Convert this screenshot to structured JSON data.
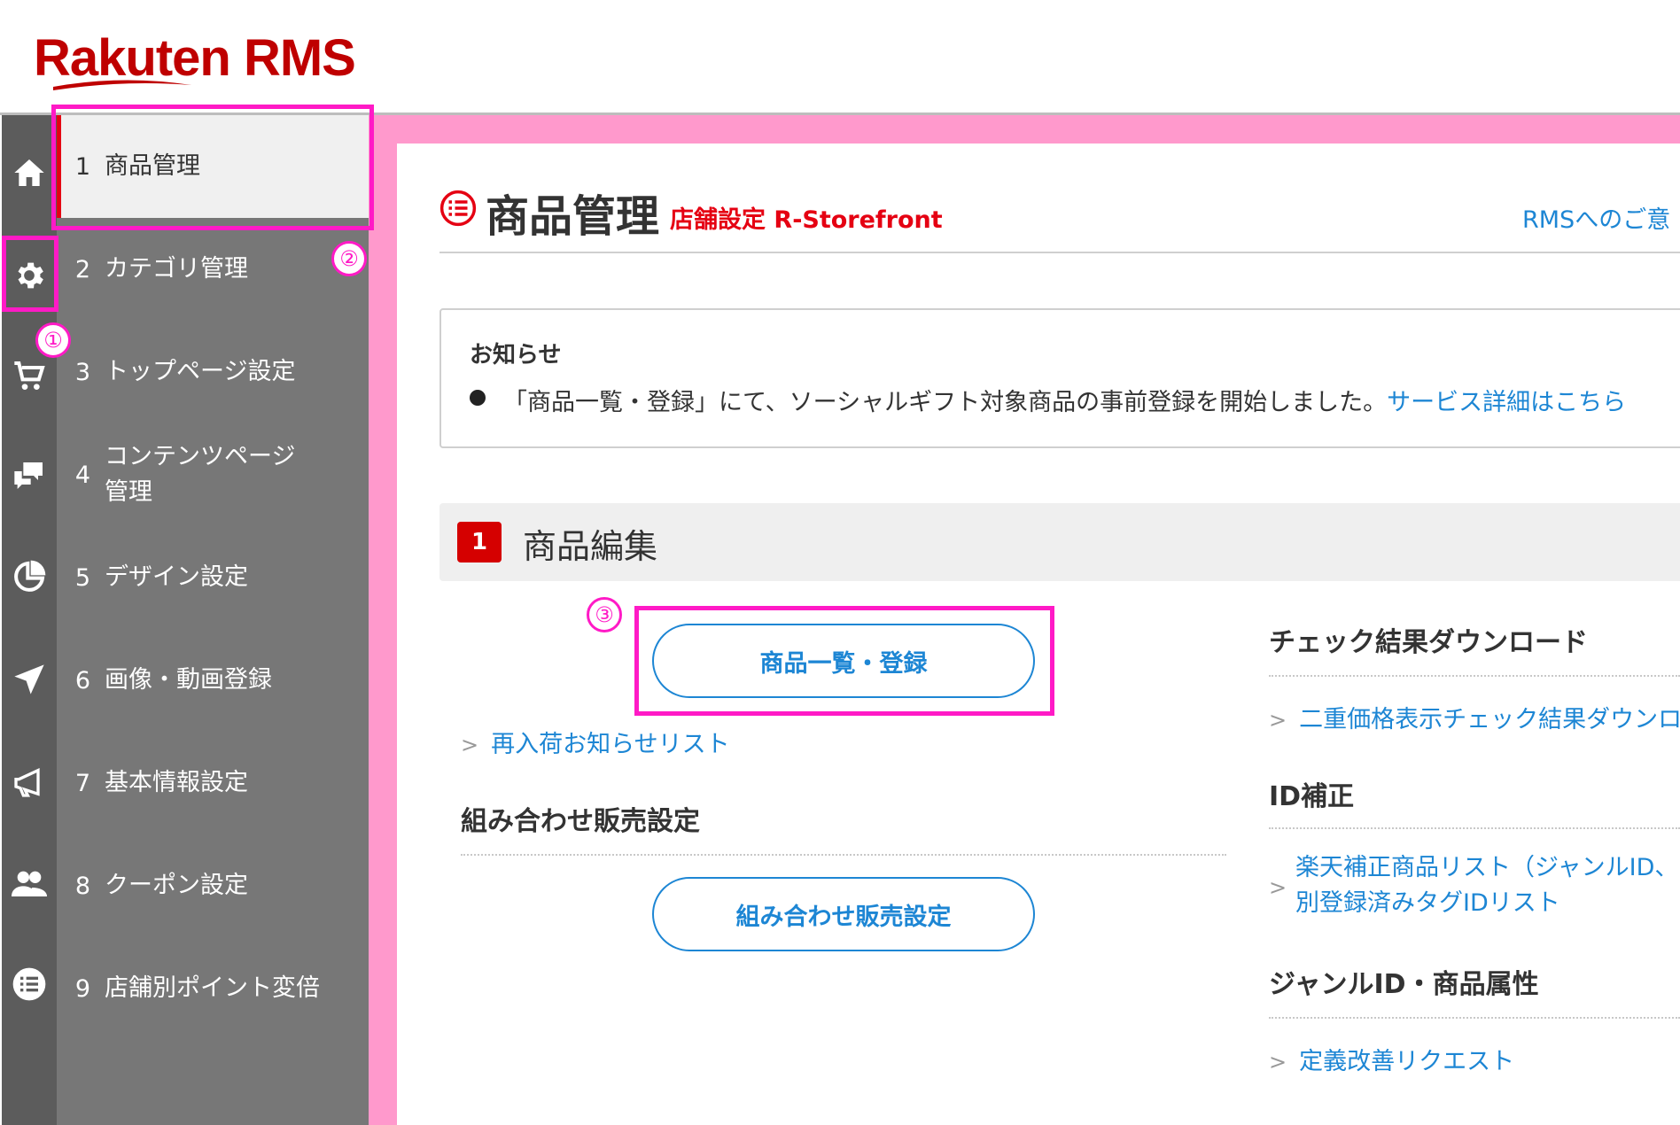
{
  "brand": {
    "name": "Rakuten RMS",
    "color": "#bf0000"
  },
  "rail_icons": [
    "home-icon",
    "gear-icon",
    "cart-icon",
    "chat-icon",
    "pie-chart-icon",
    "paper-plane-icon",
    "megaphone-icon",
    "people-icon",
    "list-icon"
  ],
  "menu": {
    "items": [
      {
        "num": "1",
        "label": "商品管理"
      },
      {
        "num": "2",
        "label": "カテゴリ管理"
      },
      {
        "num": "3",
        "label": "トップページ設定"
      },
      {
        "num": "4",
        "label": "コンテンツページ 管理"
      },
      {
        "num": "5",
        "label": "デザイン設定"
      },
      {
        "num": "6",
        "label": "画像・動画登録"
      },
      {
        "num": "7",
        "label": "基本情報設定"
      },
      {
        "num": "8",
        "label": "クーポン設定"
      },
      {
        "num": "9",
        "label": "店舗別ポイント変倍"
      }
    ]
  },
  "header": {
    "title": "商品管理",
    "subtitle": "店舗設定 R-Storefront",
    "feedback_link": "RMSへのご意"
  },
  "notice": {
    "title": "お知らせ",
    "text": "「商品一覧・登録」にて、ソーシャルギフト対象商品の事前登録を開始しました。",
    "link": "サービス詳細はこちら"
  },
  "section": {
    "number": "1",
    "title": "商品編集",
    "product_list_button": "商品一覧・登録",
    "restock_link": "再入荷お知らせリスト",
    "combo_heading": "組み合わせ販売設定",
    "combo_button": "組み合わせ販売設定"
  },
  "right_column": {
    "check_heading": "チェック結果ダウンロード",
    "check_link": "二重価格表示チェック結果ダウンロ",
    "id_heading": "ID補正",
    "id_link_line1": "楽天補正商品リスト（ジャンルID、",
    "id_link_line2": "別登録済みタグIDリスト",
    "genre_heading": "ジャンルID・商品属性",
    "genre_link": "定義改善リクエスト"
  },
  "annotations": {
    "step1": "①",
    "step2": "②",
    "step3": "③",
    "highlight_color": "#ff1ac6"
  },
  "colors": {
    "link": "#1d86d4",
    "accent_red": "#e50012",
    "menu_bg": "#777777",
    "rail_bg": "#5c5c5c",
    "frame_pink": "#ff99cc"
  }
}
